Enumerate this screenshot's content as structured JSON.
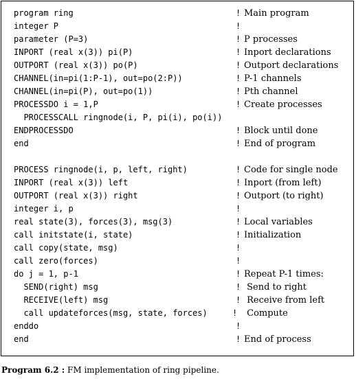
{
  "lines": [
    {
      "code": "program ring",
      "comment": "Main program"
    },
    {
      "code": "integer P",
      "comment": ""
    },
    {
      "code": "parameter (P=3)",
      "comment": "P processes"
    },
    {
      "code": "INPORT (real x(3)) pi(P)",
      "comment": "Inport declarations"
    },
    {
      "code": "OUTPORT (real x(3)) po(P)",
      "comment": "Outport declarations"
    },
    {
      "code": "CHANNEL(in=pi(1:P-1), out=po(2:P))",
      "comment": "P-1 channels"
    },
    {
      "code": "CHANNEL(in=pi(P), out=po(1))",
      "comment": "Pth channel"
    },
    {
      "code": "PROCESSDO i = 1,P",
      "comment": "Create processes"
    },
    {
      "code": "  PROCESSCALL ringnode(i, P, pi(i), po(i))",
      "comment": null
    },
    {
      "code": "ENDPROCESSDO",
      "comment": "Block until done"
    },
    {
      "code": "end",
      "comment": "End of program"
    },
    {
      "blank": true
    },
    {
      "code": "PROCESS ringnode(i, p, left, right)",
      "comment": "Code for single node"
    },
    {
      "code": "INPORT (real x(3)) left",
      "comment": "Inport (from left)"
    },
    {
      "code": "OUTPORT (real x(3)) right",
      "comment": "Outport (to right)"
    },
    {
      "code": "integer i, p",
      "comment": ""
    },
    {
      "code": "real state(3), forces(3), msg(3)",
      "comment": "Local variables"
    },
    {
      "code": "call initstate(i, state)",
      "comment": "Initialization"
    },
    {
      "code": "call copy(state, msg)",
      "comment": ""
    },
    {
      "code": "call zero(forces)",
      "comment": ""
    },
    {
      "code": "do j = 1, p-1",
      "comment": "Repeat P-1 times:"
    },
    {
      "code": "  SEND(right) msg",
      "comment": " Send to right"
    },
    {
      "code": "  RECEIVE(left) msg",
      "comment": " Receive from left"
    },
    {
      "code": "  call updateforces(msg, state, forces)",
      "comment": " Compute",
      "tight": true
    },
    {
      "code": "enddo",
      "comment": ""
    },
    {
      "code": "end",
      "comment": "End of process"
    }
  ],
  "bang": "!",
  "caption": {
    "label": "Program 6.2 :",
    "text": " FM implementation of ring pipeline."
  }
}
